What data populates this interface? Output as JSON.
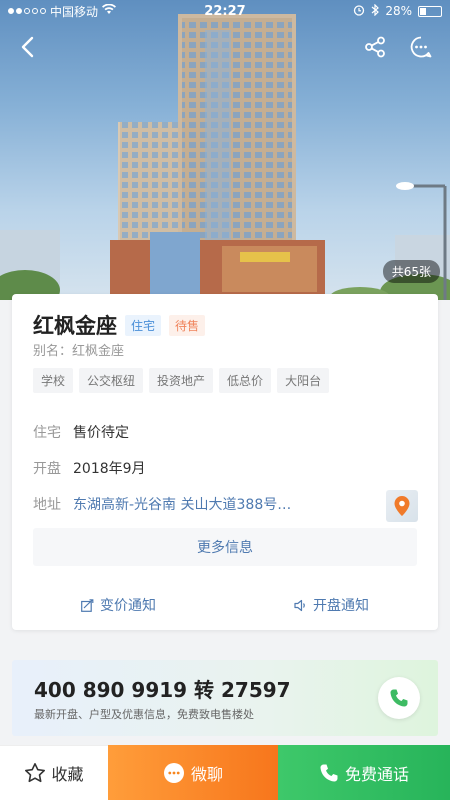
{
  "status_bar": {
    "carrier": "中国移动",
    "time": "22:27",
    "battery": "28%",
    "battery_level": 0.28
  },
  "hero": {
    "photo_count": "共65张"
  },
  "property": {
    "name": "红枫金座",
    "type_tag": "住宅",
    "status_tag": "待售",
    "alias": "别名：红枫金座",
    "features": [
      "学校",
      "公交枢纽",
      "投资地产",
      "低总价",
      "大阳台"
    ],
    "type_label": "住宅",
    "price": "售价待定",
    "opening_label": "开盘",
    "opening_date": "2018年9月",
    "address_label": "地址",
    "address": "东湖高新-光谷南 关山大道388号…"
  },
  "more_info_label": "更多信息",
  "notify": {
    "price_change": "变价通知",
    "opening": "开盘通知"
  },
  "hotline": {
    "number": "400 890 9919 转 27597",
    "description": "最新开盘、户型及优惠信息，免费致电售楼处"
  },
  "bottom_bar": {
    "favorite": "收藏",
    "chat": "微聊",
    "call": "免费通话"
  },
  "colors": {
    "accent_blue": "#4f7ab0",
    "orange": "#f7761c",
    "green": "#27b45a"
  }
}
